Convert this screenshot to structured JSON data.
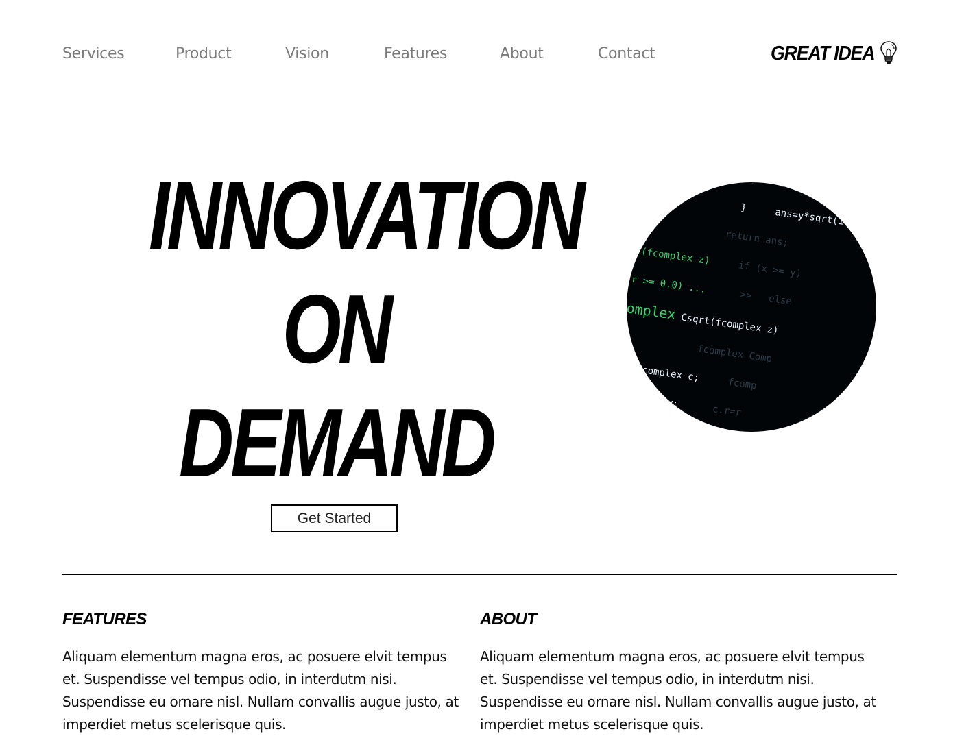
{
  "nav": {
    "items": [
      {
        "label": "Services"
      },
      {
        "label": "Product"
      },
      {
        "label": "Vision"
      },
      {
        "label": "Features"
      },
      {
        "label": "About"
      },
      {
        "label": "Contact"
      }
    ]
  },
  "logo": {
    "text": "GREAT IDEA",
    "icon": "lightbulb-icon"
  },
  "hero": {
    "title_lines": [
      "INNOVATION",
      "ON",
      "DEMAND"
    ],
    "cta_label": "Get Started",
    "image": "code-screen-image"
  },
  "sections": {
    "features": {
      "heading": "FEATURES",
      "body": "Aliquam elementum magna eros, ac posuere elvit tempus et. Suspendisse vel tempus odio, in interdutm nisi. Suspendisse eu ornare nisl. Nullam convallis augue justo, at imperdiet metus scelerisque quis."
    },
    "about": {
      "heading": "ABOUT",
      "body": "Aliquam elementum magna eros, ac posuere elvit tempus et. Suspendisse vel tempus odio, in interdutm nisi. Suspendisse eu ornare nisl. Nullam convallis augue justo, at imperdiet metus scelerisque quis."
    }
  },
  "colors": {
    "nav_text": "#7b7b7b",
    "text": "#000000",
    "background": "#ffffff",
    "code_white": "#e8f4ff",
    "code_blue": "#4fb6ff",
    "code_green": "#36d46e"
  }
}
